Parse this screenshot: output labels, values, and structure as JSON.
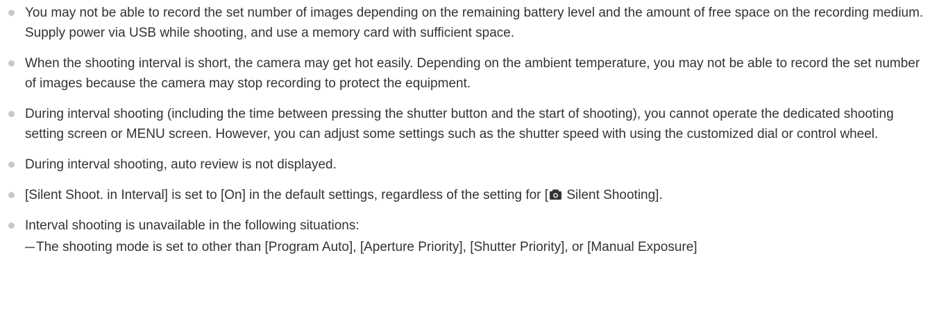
{
  "notes": [
    {
      "text": "You may not be able to record the set number of images depending on the remaining battery level and the amount of free space on the recording medium. Supply power via USB while shooting, and use a memory card with sufficient space."
    },
    {
      "text": "When the shooting interval is short, the camera may get hot easily. Depending on the ambient temperature, you may not be able to record the set number of images because the camera may stop recording to protect the equipment."
    },
    {
      "text": "During interval shooting (including the time between pressing the shutter button and the start of shooting), you cannot operate the dedicated shooting setting screen or MENU screen. However, you can adjust some settings such as the shutter speed with using the customized dial or control wheel."
    },
    {
      "text": "During interval shooting, auto review is not displayed."
    },
    {
      "text_before": "[Silent Shoot. in Interval] is set to [On] in the default settings, regardless of the setting for [",
      "icon": "camera-icon",
      "text_after": " Silent Shooting]."
    },
    {
      "text": "Interval shooting is unavailable in the following situations:",
      "sub": "The shooting mode is set to other than [Program Auto], [Aperture Priority], [Shutter Priority], or [Manual Exposure]"
    }
  ],
  "colors": {
    "text": "#333333",
    "bullet": "#c8c8c8",
    "icon": "#333333"
  }
}
